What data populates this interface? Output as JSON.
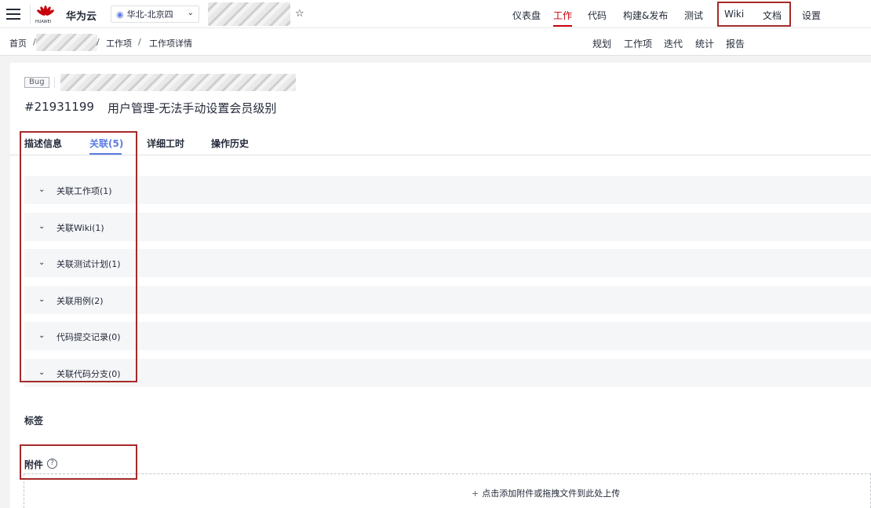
{
  "header": {
    "brand": "华为云",
    "logo_text": "HUAWEI",
    "region": "华北-北京四",
    "nav": [
      "仪表盘",
      "工作",
      "代码",
      "构建&发布",
      "测试",
      "Wiki",
      "文档",
      "设置"
    ],
    "active_nav": "工作"
  },
  "breadcrumb": {
    "home": "首页",
    "sep": "/",
    "work_items": "工作项",
    "detail": "工作项详情"
  },
  "subnav": [
    "规划",
    "工作项",
    "迭代",
    "统计",
    "报告"
  ],
  "item": {
    "type": "Bug",
    "id": "#21931199",
    "title": "用户管理-无法手动设置会员级别"
  },
  "tabs": {
    "description": "描述信息",
    "relations": "关联(5)",
    "worktime": "详细工时",
    "history": "操作历史"
  },
  "relations": [
    "关联工作项(1)",
    "关联Wiki(1)",
    "关联测试计划(1)",
    "关联用例(2)",
    "代码提交记录(0)",
    "关联代码分支(0)"
  ],
  "sections": {
    "tags": "标签",
    "attachments": "附件",
    "help": "?"
  },
  "upload": {
    "plus": "+",
    "text": "点击添加附件或拖拽文件到此处上传"
  },
  "colors": {
    "brand_red": "#c7000b",
    "accent_blue": "#5e7ce0",
    "highlight_box": "#a52a2a"
  }
}
